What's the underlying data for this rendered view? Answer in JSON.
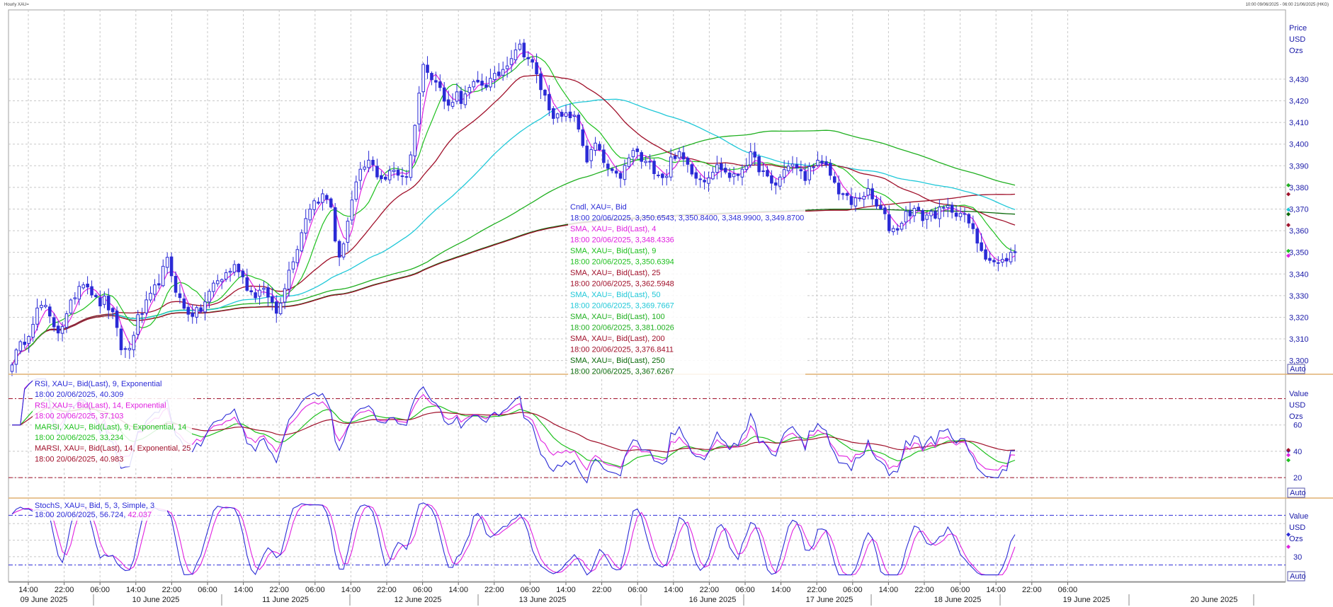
{
  "header": {
    "title": "Hourly XAU=",
    "range": "10:00 09/06/2025 - 06:00 21/06/2025 (HKG)"
  },
  "axis_labels": {
    "price": [
      "Price",
      "USD",
      "Ozs"
    ],
    "rsi": [
      "Value",
      "USD",
      "Ozs"
    ],
    "stoch": [
      "Value",
      "USD",
      "Ozs"
    ],
    "auto": "Auto"
  },
  "colors": {
    "candle": "#2b2bd6",
    "sma4": "#e020e0",
    "sma9": "#1ec01e",
    "sma25": "#a0102a",
    "sma50": "#20c8d8",
    "sma100": "#20b020",
    "sma200": "#a0102a",
    "sma250": "#0a6a0a",
    "rsi9": "#2b2bd6",
    "rsi14": "#e020e0",
    "marsi9": "#1ec01e",
    "marsi14": "#a0102a",
    "stoch_k": "#2b2bd6",
    "stoch_d": "#e020e0",
    "grid": "#c8c8c8",
    "divider": "#e0b070"
  },
  "legend_price": [
    {
      "text": "Cndl, XAU=, Bid",
      "color": "#2b2bd6"
    },
    {
      "text": "18:00 20/06/2025, 3,350.6543, 3,350.8400, 3,348.9900, 3,349.8700",
      "color": "#2b2bd6"
    },
    {
      "text": "SMA, XAU=, Bid(Last),  4",
      "color": "#e020e0"
    },
    {
      "text": "18:00 20/06/2025, 3,348.4336",
      "color": "#e020e0"
    },
    {
      "text": "SMA, XAU=, Bid(Last),  9",
      "color": "#1ec01e"
    },
    {
      "text": "18:00 20/06/2025, 3,350.6394",
      "color": "#1ec01e"
    },
    {
      "text": "SMA, XAU=, Bid(Last),  25",
      "color": "#a0102a"
    },
    {
      "text": "18:00 20/06/2025, 3,362.5948",
      "color": "#a0102a"
    },
    {
      "text": "SMA, XAU=, Bid(Last),  50",
      "color": "#20c8d8"
    },
    {
      "text": "18:00 20/06/2025, 3,369.7667",
      "color": "#20c8d8"
    },
    {
      "text": "SMA, XAU=, Bid(Last),  100",
      "color": "#20b020"
    },
    {
      "text": "18:00 20/06/2025, 3,381.0026",
      "color": "#20b020"
    },
    {
      "text": "SMA, XAU=, Bid(Last),  200",
      "color": "#a0102a"
    },
    {
      "text": "18:00 20/06/2025, 3,376.8411",
      "color": "#a0102a"
    },
    {
      "text": "SMA, XAU=, Bid(Last),  250",
      "color": "#0a6a0a"
    },
    {
      "text": "18:00 20/06/2025, 3,367.6267",
      "color": "#0a6a0a"
    }
  ],
  "legend_rsi": [
    {
      "text": "RSI, XAU=, Bid(Last),  9, Exponential",
      "color": "#2b2bd6"
    },
    {
      "text": "18:00 20/06/2025, 40.309",
      "color": "#2b2bd6"
    },
    {
      "text": "RSI, XAU=, Bid(Last),  14, Exponential",
      "color": "#e020e0"
    },
    {
      "text": "18:00 20/06/2025, 37.103",
      "color": "#e020e0"
    },
    {
      "text": "MARSI, XAU=, Bid(Last),  9, Exponential, 14",
      "color": "#1ec01e"
    },
    {
      "text": "18:00 20/06/2025, 33.234",
      "color": "#1ec01e"
    },
    {
      "text": "MARSI, XAU=, Bid(Last),  14, Exponential, 25",
      "color": "#a0102a"
    },
    {
      "text": "18:00 20/06/2025, 40.983",
      "color": "#a0102a"
    }
  ],
  "legend_stoch": [
    {
      "text": "StochS, XAU=, Bid,  5, 3, Simple, 3",
      "color": "#2b2bd6"
    },
    {
      "text": "18:00 20/06/2025, 56.724, ",
      "color": "#2b2bd6",
      "extra": "42.037",
      "extra_color": "#e020e0"
    }
  ],
  "chart_data": [
    {
      "type": "candlestick",
      "name_note": "price panel",
      "ylim": [
        3294,
        3462
      ],
      "yticks": [
        3300,
        3310,
        3320,
        3330,
        3340,
        3350,
        3360,
        3370,
        3380,
        3390,
        3400,
        3410,
        3420,
        3430
      ],
      "ytick_labels": [
        "3,300",
        "3,310",
        "3,320",
        "3,330",
        "3,340",
        "3,350",
        "3,360",
        "3,370",
        "3,380",
        "3,390",
        "3,400",
        "3,410",
        "3,420",
        "3,430"
      ],
      "close_path": [
        3300,
        3306,
        3312,
        3322,
        3326,
        3318,
        3314,
        3320,
        3330,
        3338,
        3334,
        3326,
        3328,
        3320,
        3306,
        3304,
        3318,
        3324,
        3330,
        3338,
        3346,
        3334,
        3324,
        3322,
        3322,
        3328,
        3336,
        3338,
        3342,
        3344,
        3336,
        3330,
        3332,
        3330,
        3322,
        3334,
        3346,
        3356,
        3370,
        3374,
        3376,
        3372,
        3344,
        3362,
        3378,
        3388,
        3392,
        3386,
        3384,
        3388,
        3386,
        3386,
        3416,
        3438,
        3432,
        3426,
        3416,
        3424,
        3420,
        3426,
        3428,
        3428,
        3430,
        3434,
        3440,
        3446,
        3442,
        3436,
        3426,
        3418,
        3412,
        3412,
        3414,
        3406,
        3392,
        3400,
        3392,
        3386,
        3384,
        3390,
        3398,
        3392,
        3390,
        3388,
        3384,
        3396,
        3394,
        3390,
        3386,
        3384,
        3388,
        3390,
        3386,
        3384,
        3390,
        3394,
        3390,
        3384,
        3380,
        3386,
        3392,
        3388,
        3384,
        3392,
        3390,
        3388,
        3380,
        3376,
        3372,
        3376,
        3378,
        3372,
        3368,
        3360,
        3362,
        3368,
        3370,
        3366,
        3368,
        3368,
        3370,
        3370,
        3368,
        3364,
        3356,
        3350,
        3346,
        3344,
        3348,
        3350
      ],
      "sma_last": {
        "4": 3348.4336,
        "9": 3350.6394,
        "25": 3362.5948,
        "50": 3369.7667,
        "100": 3381.0026,
        "200": 3376.8411,
        "250": 3367.6267
      }
    },
    {
      "type": "line",
      "name_note": "RSI panel",
      "ylim": [
        5,
        98
      ],
      "yticks": [
        20,
        40,
        60
      ],
      "ytick_labels": [
        "20",
        "40",
        "60"
      ],
      "ref_lines": [
        20,
        80
      ],
      "series_last": {
        "rsi9": 40.309,
        "rsi14": 37.103,
        "marsi9": 33.234,
        "marsi14": 40.983
      }
    },
    {
      "type": "line",
      "name_note": "Stochastic panel",
      "ylim": [
        0,
        100
      ],
      "yticks": [
        30
      ],
      "ytick_labels": [
        "30"
      ],
      "ref_lines": [
        20,
        80
      ],
      "series_last": {
        "k": 56.724,
        "d": 42.037
      }
    }
  ],
  "time_axis": {
    "time_labels": [
      "14:00",
      "22:00",
      "06:00",
      "14:00",
      "22:00",
      "06:00",
      "14:00",
      "22:00",
      "06:00",
      "14:00",
      "22:00",
      "06:00",
      "14:00",
      "22:00",
      "06:00",
      "14:00",
      "22:00",
      "06:00",
      "14:00",
      "22:00",
      "06:00",
      "14:00",
      "22:00",
      "06:00",
      "14:00",
      "22:00",
      "06:00",
      "14:00",
      "22:00",
      "06:00"
    ],
    "date_labels": [
      "09 June 2025",
      "10 June 2025",
      "11 June 2025",
      "12 June 2025",
      "13 June 2025",
      "16 June 2025",
      "17 June 2025",
      "18 June 2025",
      "19 June 2025",
      "20 June 2025"
    ]
  }
}
